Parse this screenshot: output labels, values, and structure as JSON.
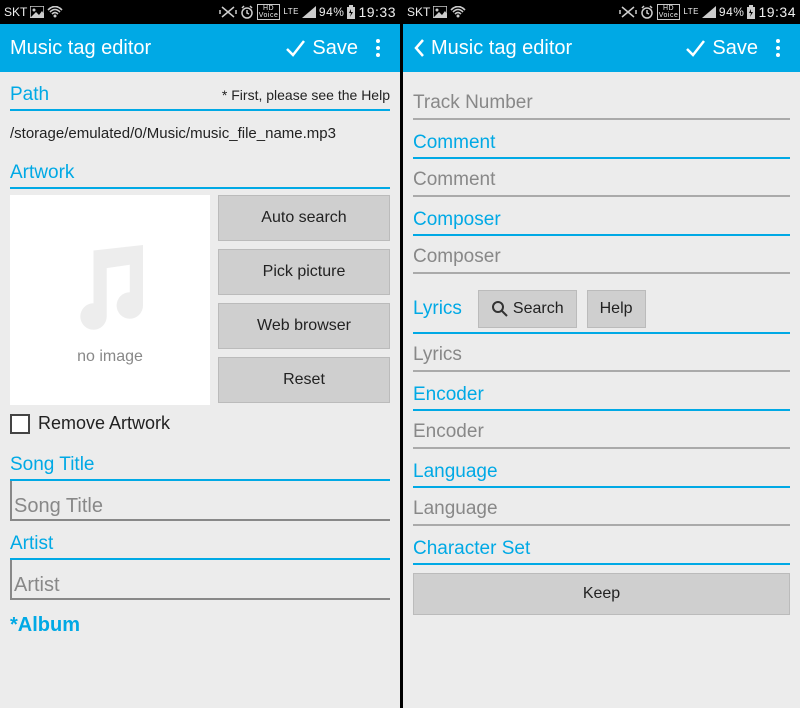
{
  "status": {
    "carrier": "SKT",
    "battery": "94%",
    "clock_left": "19:33",
    "clock_right": "19:34",
    "hd_voice": "HD",
    "voice": "Voice",
    "lte": "LTE"
  },
  "appbar": {
    "title": "Music tag editor",
    "save": "Save"
  },
  "left": {
    "path_label": "Path",
    "path_notice": "* First, please see the Help",
    "path_value": "/storage/emulated/0/Music/music_file_name.mp3",
    "artwork_label": "Artwork",
    "no_image": "no image",
    "btn_auto": "Auto search",
    "btn_pick": "Pick picture",
    "btn_web": "Web browser",
    "btn_reset": "Reset",
    "remove_artwork": "Remove Artwork",
    "song_title_label": "Song Title",
    "song_title_placeholder": "Song Title",
    "artist_label": "Artist",
    "artist_placeholder": "Artist",
    "album_label": "*Album"
  },
  "right": {
    "track_placeholder": "Track Number",
    "comment_label": "Comment",
    "comment_placeholder": "Comment",
    "composer_label": "Composer",
    "composer_placeholder": "Composer",
    "lyrics_label": "Lyrics",
    "btn_search": "Search",
    "btn_help": "Help",
    "lyrics_placeholder": "Lyrics",
    "encoder_label": "Encoder",
    "encoder_placeholder": "Encoder",
    "language_label": "Language",
    "language_placeholder": "Language",
    "charset_label": "Character Set",
    "btn_keep": "Keep"
  }
}
